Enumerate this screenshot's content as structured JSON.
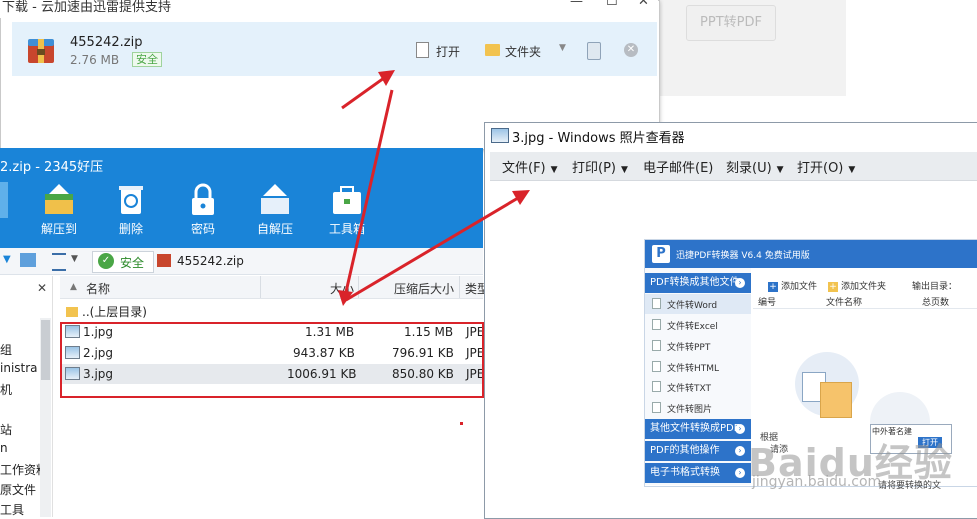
{
  "background_app": {
    "left_fragment": "PD",
    "button_label": "PPT转PDF"
  },
  "download_dialog": {
    "title": "下载 - 云加速由迅雷提供支持",
    "min_label": "—",
    "max_label": "☐",
    "close_label": "✕",
    "file_name": "455242.zip",
    "file_size": "2.76 MB",
    "safe_badge": "安全",
    "open_label": "打开",
    "folder_label": "文件夹",
    "caret": "▼",
    "dismiss_label": "✕"
  },
  "zip_window": {
    "title": "2.zip - 2345好压",
    "toolbar": [
      {
        "label": "解压到",
        "icon": "extract-icon"
      },
      {
        "label": "删除",
        "icon": "recycle-icon"
      },
      {
        "label": "密码",
        "icon": "lock-icon"
      },
      {
        "label": "自解压",
        "icon": "self-extract-icon"
      },
      {
        "label": "工具箱",
        "icon": "toolbox-icon"
      }
    ],
    "address": {
      "safe_label": "安全",
      "path": "455242.zip"
    },
    "columns": {
      "name": "名称",
      "size": "大小",
      "packed": "压缩后大小",
      "type": "类型"
    },
    "parent_dir": "..(上层目录)",
    "files": [
      {
        "name": "1.jpg",
        "size": "1.31 MB",
        "packed": "1.15 MB",
        "type": "JPE"
      },
      {
        "name": "2.jpg",
        "size": "943.87 KB",
        "packed": "796.91 KB",
        "type": "JPE"
      },
      {
        "name": "3.jpg",
        "size": "1006.91 KB",
        "packed": "850.80 KB",
        "type": "JPE"
      }
    ],
    "tree_fragments": [
      "组",
      "inistra",
      "机",
      "站",
      "n",
      "工作资料",
      "原文件",
      "工具"
    ],
    "tree_close": "✕"
  },
  "photo_viewer": {
    "title": "3.jpg - Windows 照片查看器",
    "menus": [
      "文件(F)",
      "打印(P)",
      "电子邮件(E)",
      "刻录(U)",
      "打开(O)"
    ],
    "menu_caret": "▼"
  },
  "embedded_app": {
    "logo": "P",
    "title": "迅捷PDF转换器 V6.4 免费试用版",
    "side_header1": "PDF转换成其他文件",
    "side_items": [
      "文件转Word",
      "文件转Excel",
      "文件转PPT",
      "文件转HTML",
      "文件转TXT",
      "文件转图片"
    ],
    "side_header2": "其他文件转换成PDF",
    "side_header3": "PDF的其他操作",
    "side_header4": "电子书格式转换",
    "circle_mark": "›",
    "toolbar": [
      "添加文件",
      "添加文件夹",
      "输出目录："
    ],
    "columns": [
      "编号",
      "文件名称",
      "总页数"
    ],
    "hint1": "根据",
    "hint2": "请添",
    "hint3": "请将要转换的文",
    "popup_text": "中外著名建",
    "popup_button": "打开",
    "watermark": "Baidu经验",
    "watermark_sub": "jingyan.baidu.com"
  },
  "colors": {
    "zip_blue": "#1a84d8",
    "app_blue": "#2d73c9",
    "annotation_red": "#d9232a"
  }
}
